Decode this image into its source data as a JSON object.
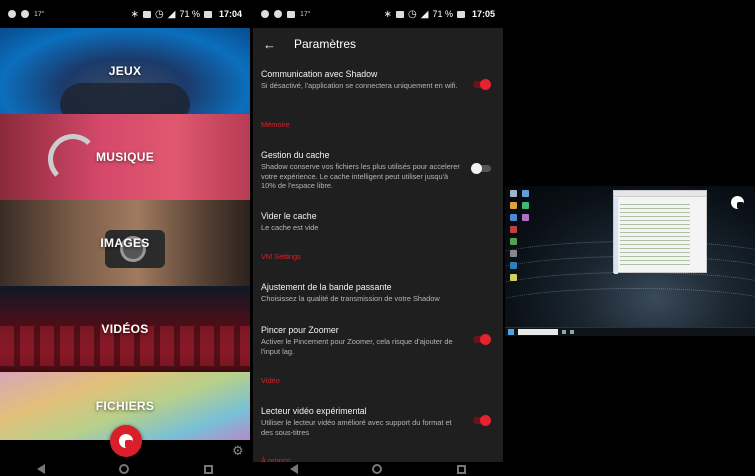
{
  "panel1": {
    "status": {
      "temp": "17°",
      "battery": "71 %",
      "time": "17:04"
    },
    "tiles": [
      {
        "label": "JEUX"
      },
      {
        "label": "MUSIQUE"
      },
      {
        "label": "IMAGES"
      },
      {
        "label": "VIDÉOS"
      },
      {
        "label": "FICHIERS"
      }
    ],
    "icons": {
      "fab": "shadow-logo-icon",
      "settings": "gear-icon"
    }
  },
  "panel2": {
    "status": {
      "temp": "17°",
      "battery": "71 %",
      "time": "17:05"
    },
    "toolbar": {
      "title": "Paramètres"
    },
    "items": {
      "communication": {
        "title": "Communication avec Shadow",
        "subtitle": "Si désactivé, l'application se connectera uniquement en wifi.",
        "enabled": true
      },
      "section_memoire": "Mémoire",
      "cache_management": {
        "title": "Gestion du cache",
        "subtitle": "Shadow conserve vos fichiers les plus utilisés pour accelerer votre expérience. Le cache intelligent peut utiliser jusqu'à 10% de l'espace libre.",
        "enabled": false
      },
      "clear_cache": {
        "title": "Vider le cache",
        "subtitle": "Le cache est vide"
      },
      "section_vm": "VM Settings",
      "bandwidth": {
        "title": "Ajustement de la bande passante",
        "subtitle": "Choisissez la qualité de transmission de votre Shadow"
      },
      "pinch_zoom": {
        "title": "Pincer pour Zoomer",
        "subtitle": "Activer le Pincement pour Zoomer, cela risque d'ajouter de l'input lag.",
        "enabled": true
      },
      "section_video": "Vidéo",
      "video_player": {
        "title": "Lecteur vidéo expérimental",
        "subtitle": "Utiliser le lecteur vidéo amélioré avec support du format et des sous-titres",
        "enabled": true
      },
      "section_about": "À propos"
    }
  },
  "panel3": {
    "icons": {
      "fab": "shadow-logo-icon"
    }
  },
  "colors": {
    "accent": "#d81f2a",
    "settings_bg": "#1f1f1f"
  }
}
